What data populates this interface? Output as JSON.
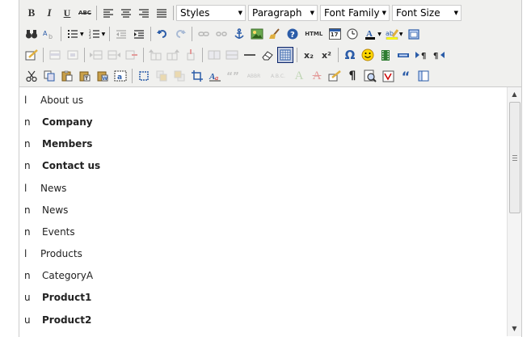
{
  "toolbar": {
    "row1": {
      "bold": "B",
      "italic": "I",
      "underline": "U",
      "strikethrough": "ABC",
      "styles": "Styles",
      "paragraph": "Paragraph",
      "font_family": "Font Family",
      "font_size": "Font Size"
    },
    "row2": {
      "html": "HTML",
      "date": "17"
    },
    "row3": {
      "subscript": "x₂",
      "superscript": "x²"
    },
    "row4": {
      "abbr": "ABBR",
      "acronym": "A.B.C."
    }
  },
  "content": {
    "lines": [
      {
        "bullet": "l",
        "text": "About us"
      },
      {
        "bullet": "n",
        "text": "Company"
      },
      {
        "bullet": "n",
        "text": "Members"
      },
      {
        "bullet": "n",
        "text": "Contact us"
      },
      {
        "bullet": "l",
        "text": "News"
      },
      {
        "bullet": "n",
        "text": "News"
      },
      {
        "bullet": "n",
        "text": "Events"
      },
      {
        "bullet": "l",
        "text": "Products"
      },
      {
        "bullet": "n",
        "text": "CategoryA"
      },
      {
        "bullet": "u",
        "text": "Product1"
      },
      {
        "bullet": "u",
        "text": "Product2"
      }
    ]
  },
  "colors": {
    "toolbar_bg": "#f0f0ee",
    "border": "#cccccc",
    "icon_blue": "#2b5ca8",
    "active_bg": "#c2cbe0"
  }
}
